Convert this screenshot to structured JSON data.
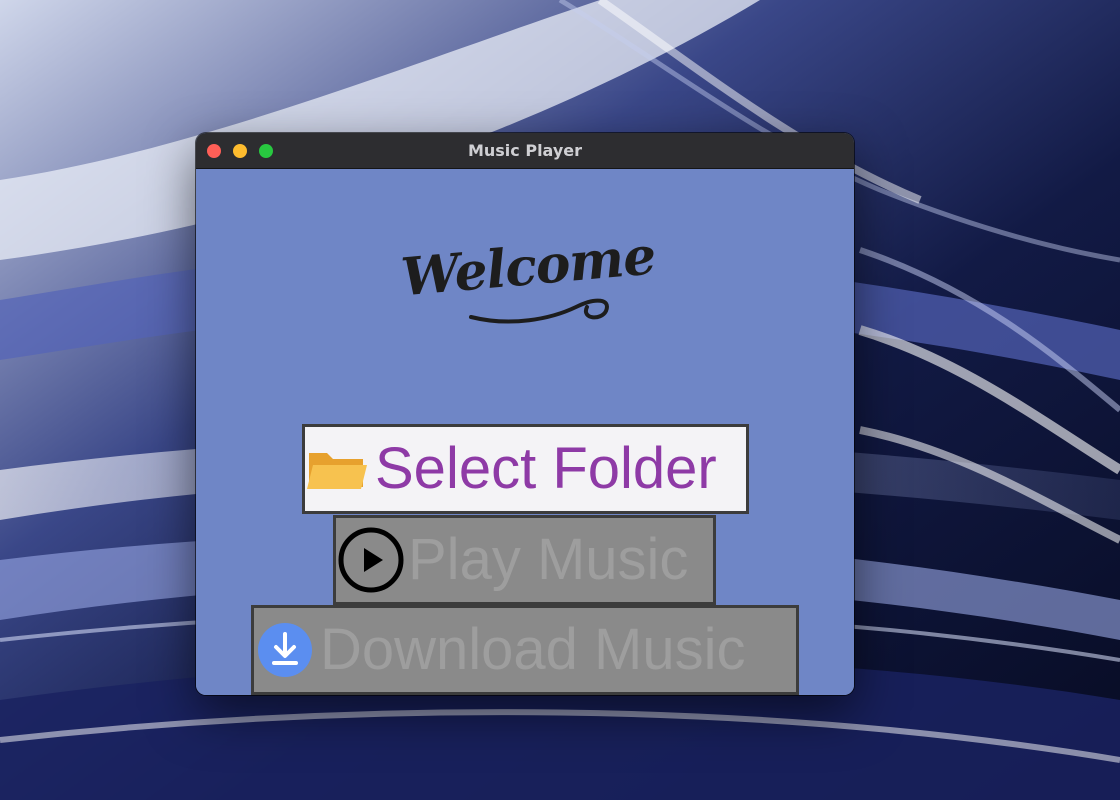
{
  "window": {
    "title": "Music Player"
  },
  "welcome": {
    "text": "Welcome"
  },
  "buttons": {
    "select_folder": {
      "label": "Select Folder",
      "icon": "folder-icon"
    },
    "play_music": {
      "label": "Play Music",
      "icon": "play-circle-icon"
    },
    "download_music": {
      "label": "Download Music",
      "icon": "download-icon"
    }
  },
  "colors": {
    "window_background": "#6f86c6",
    "select_folder_text": "#8e3aa6",
    "disabled_text": "#9e9e9e",
    "disabled_button": "#8a8a8a",
    "folder_icon": "#f2b33d",
    "download_icon": "#5b8ef0"
  }
}
